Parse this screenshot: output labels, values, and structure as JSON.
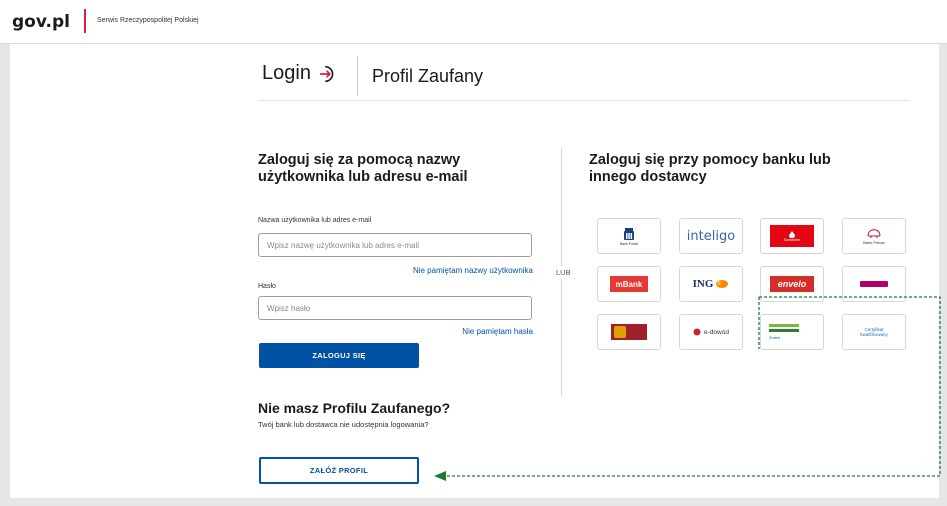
{
  "header": {
    "logo": "gov.pl",
    "site_name": "Serwis Rzeczypospolitej Polskiej"
  },
  "titles": {
    "login": "Login",
    "profil": "Profil Zaufany"
  },
  "left": {
    "heading": "Zaloguj się za pomocą nazwy użytkownika lub adresu e-mail",
    "username_label": "Nazwa użytkownika lub adres e-mail",
    "username_placeholder": "Wpisz nazwę użytkownika lub adres e-mail",
    "username_value": "",
    "forgot_username": "Nie pamiętam nazwy użytkownika",
    "password_label": "Hasło",
    "password_placeholder": "Wpisz hasło",
    "password_value": "",
    "forgot_password": "Nie pamiętam hasła",
    "login_button": "ZALOGUJ SIĘ",
    "no_profile_heading": "Nie masz Profilu Zaufanego?",
    "no_profile_sub": "Twój bank lub dostawca nie udostępnia logowania?",
    "create_button": "ZAŁÓŻ PROFIL"
  },
  "or_label": "LUB",
  "right": {
    "heading": "Zaloguj się przy pomocy banku lub innego dostawcy",
    "providers": [
      {
        "name": "PKO Bank Polski",
        "caption": "Bank Polski",
        "color": "#1c3f7c"
      },
      {
        "name": "inteligo",
        "color": "#3a64a7"
      },
      {
        "name": "Santander",
        "caption": "Santander",
        "color": "#e30613"
      },
      {
        "name": "Bank Pekao",
        "caption": "Bank Pekao",
        "color": "#c8102e"
      },
      {
        "name": "mBank",
        "color": "#e53935"
      },
      {
        "name": "ING",
        "color": "#1a2c6b"
      },
      {
        "name": "envelo",
        "color": "#d42e2a"
      },
      {
        "name": "Millennium",
        "color": "#b0006a"
      },
      {
        "name": "Alior Bank",
        "color": "#a0202a"
      },
      {
        "name": "e-dowód",
        "color": "#c62828"
      },
      {
        "name": "Bank Spółdzielczy",
        "caption": "Zmień",
        "color": "#2e7d32"
      },
      {
        "name": "Certyfikat kwalifikowany",
        "caption_1": "Certyfikat",
        "caption_2": "kwalifikowany",
        "color": "#1e6fb8"
      }
    ]
  },
  "colors": {
    "primary": "#0052a5",
    "gov_red": "#d4213d",
    "annotation": "#1e7b34"
  }
}
